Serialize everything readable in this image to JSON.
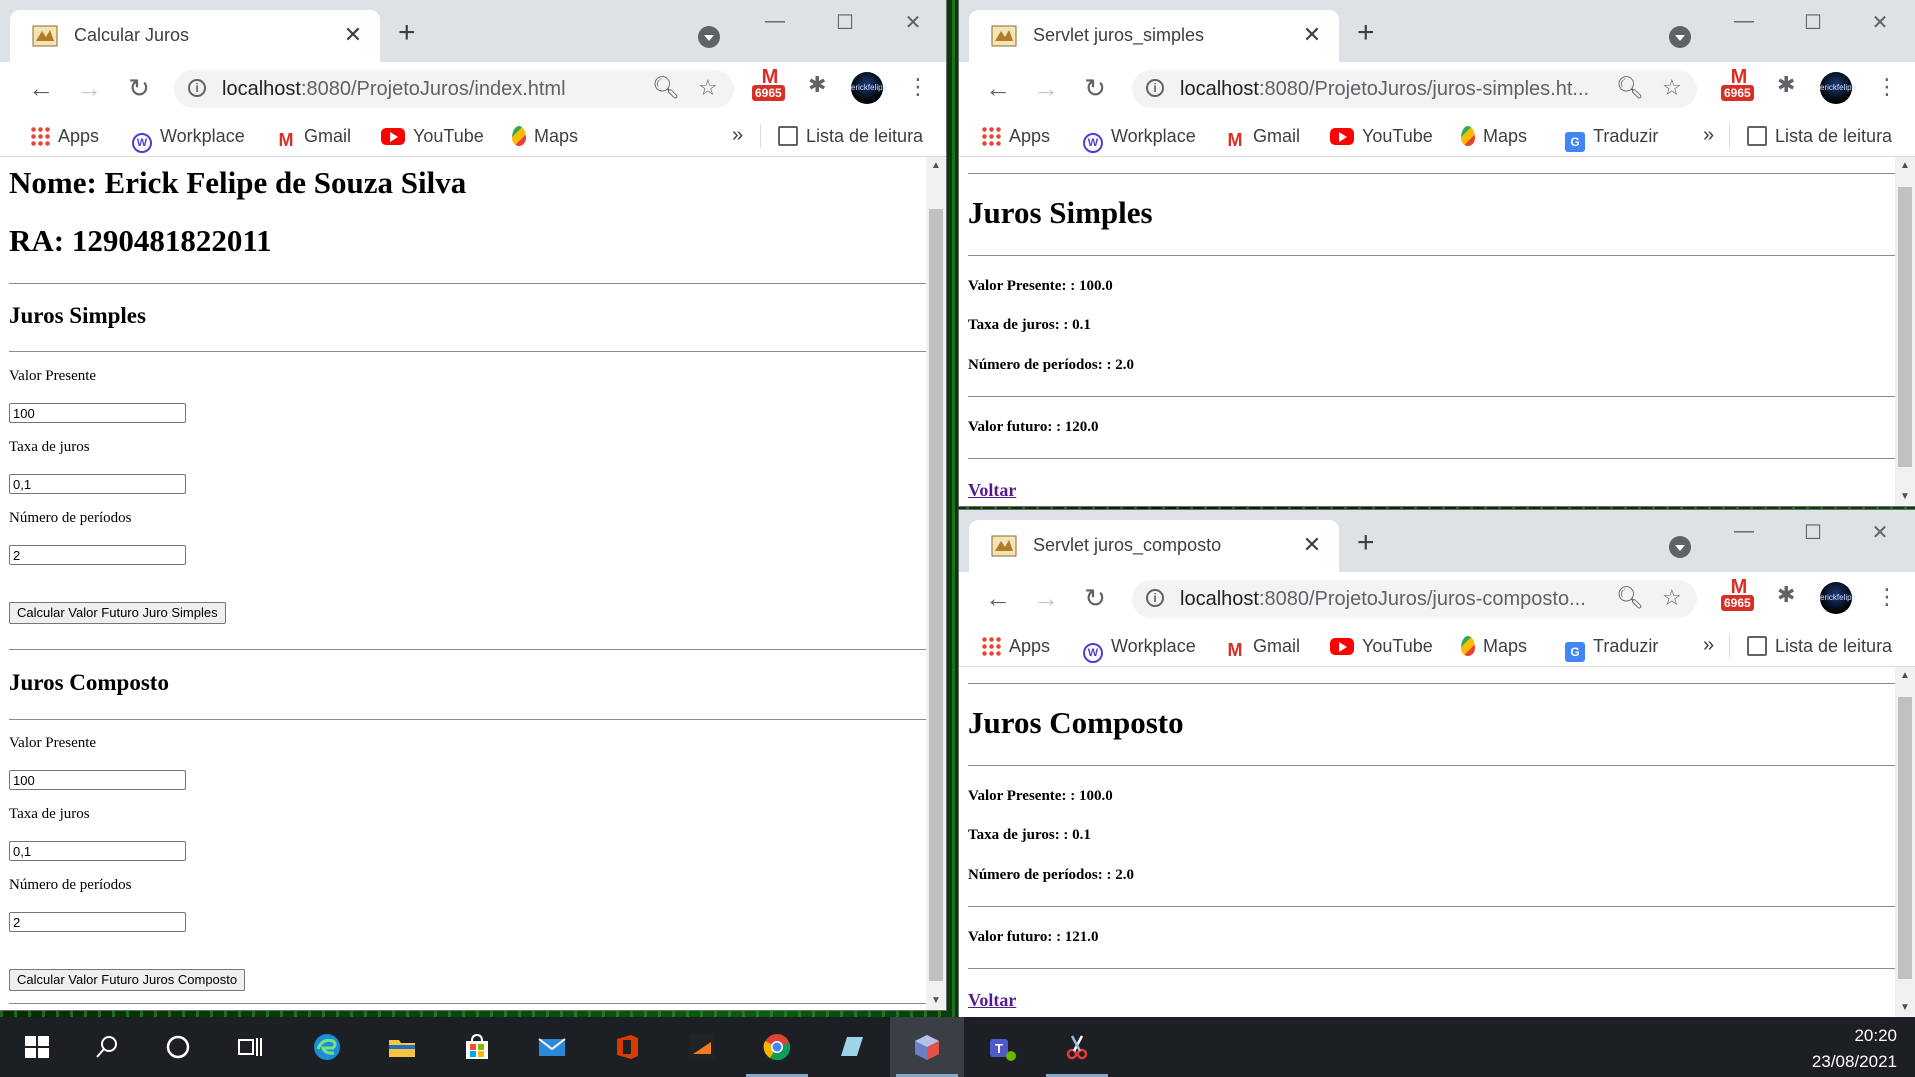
{
  "colors": {
    "chrome_frame": "#dee1e6",
    "link_visited": "#551a8b",
    "taskbar": "#1c1f24",
    "gmail_red": "#d93025"
  },
  "bookmarks_common": {
    "apps": "Apps",
    "workplace": "Workplace",
    "gmail": "Gmail",
    "youtube": "YouTube",
    "maps": "Maps",
    "traduzir": "Traduzir",
    "more": "»",
    "reading_list": "Lista de leitura"
  },
  "extensions": {
    "gmail_badge": "6965",
    "avatar_text": "erickfelipe"
  },
  "window_left": {
    "tab_title": "Calcular Juros",
    "url_host": "localhost",
    "url_rest": ":8080/ProjetoJuros/index.html",
    "page": {
      "name": "Nome: Erick Felipe de Souza Silva",
      "ra": "RA: 1290481822011",
      "simples": {
        "heading": "Juros Simples",
        "valor_presente_label": "Valor Presente",
        "valor_presente_value": "100",
        "taxa_label": "Taxa de juros",
        "taxa_value": "0,1",
        "periodos_label": "Número de períodos",
        "periodos_value": "2",
        "button": "Calcular Valor Futuro Juro Simples"
      },
      "composto": {
        "heading": "Juros Composto",
        "valor_presente_label": "Valor Presente",
        "valor_presente_value": "100",
        "taxa_label": "Taxa de juros",
        "taxa_value": "0,1",
        "periodos_label": "Número de períodos",
        "periodos_value": "2",
        "button": "Calcular Valor Futuro Juros Composto"
      }
    }
  },
  "window_top_right": {
    "tab_title": "Servlet juros_simples",
    "url_host": "localhost",
    "url_rest": ":8080/ProjetoJuros/juros-simples.ht...",
    "page": {
      "heading": "Juros Simples",
      "valor_presente": "Valor Presente: : 100.0",
      "taxa": "Taxa de juros: : 0.1",
      "periodos": "Número de períodos: : 2.0",
      "valor_futuro": "Valor futuro: : 120.0",
      "voltar": "Voltar"
    }
  },
  "window_bottom_right": {
    "tab_title": "Servlet juros_composto",
    "url_host": "localhost",
    "url_rest": ":8080/ProjetoJuros/juros-composto...",
    "page": {
      "heading": "Juros Composto",
      "valor_presente": "Valor Presente: : 100.0",
      "taxa": "Taxa de juros: : 0.1",
      "periodos": "Número de períodos: : 2.0",
      "valor_futuro": "Valor futuro: : 121.0",
      "voltar": "Voltar"
    }
  },
  "taskbar": {
    "time": "20:20",
    "date": "23/08/2021"
  }
}
